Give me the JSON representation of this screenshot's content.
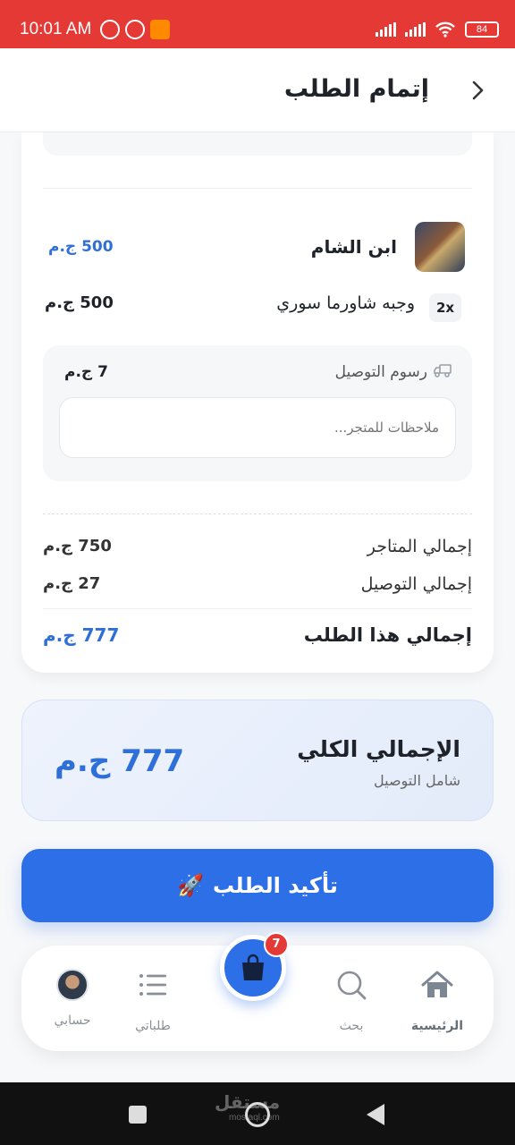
{
  "status_bar": {
    "time": "10:01 AM",
    "battery": "84",
    "icons": [
      "alarm-icon",
      "whatsapp-icon",
      "app-notification-icon",
      "signal-icon",
      "signal-icon",
      "wifi-icon",
      "battery-icon"
    ]
  },
  "header": {
    "title": "إتمام الطلب",
    "back_icon": "chevron-right-icon"
  },
  "store": {
    "name": "ابن الشام",
    "subtotal": "500 ج.م",
    "items": [
      {
        "qty": "2x",
        "name": "وجبه شاورما سوري",
        "price": "500 ج.م"
      }
    ],
    "delivery_label": "رسوم التوصيل",
    "delivery_fee": "7 ج.م",
    "notes_placeholder": "ملاحظات للمتجر..."
  },
  "summary": {
    "stores_total_label": "إجمالي المتاجر",
    "stores_total_value": "750 ج.م",
    "delivery_total_label": "إجمالي التوصيل",
    "delivery_total_value": "27 ج.م",
    "order_total_label": "إجمالي هذا الطلب",
    "order_total_value": "777 ج.م"
  },
  "grand_total": {
    "title": "الإجمالي الكلي",
    "subtitle": "شامل التوصيل",
    "amount": "777 ج.م"
  },
  "confirm_button": {
    "label": "تأكيد الطلب",
    "emoji": "🚀"
  },
  "bottom_nav": {
    "items": [
      {
        "label": "الرئيسية",
        "icon": "home-icon",
        "active": true
      },
      {
        "label": "بحث",
        "icon": "search-icon",
        "active": false
      },
      {
        "label": "طلباتي",
        "icon": "list-icon",
        "active": false
      },
      {
        "label": "حسابي",
        "icon": "avatar",
        "active": false
      }
    ],
    "cart_icon": "shopping-bag-icon",
    "cart_badge": "7"
  },
  "watermark": {
    "text": "مستقل",
    "sub": "mostaql.com"
  },
  "colors": {
    "accent": "#2d6fe6",
    "status_bar": "#e53935",
    "badge": "#e53935"
  }
}
